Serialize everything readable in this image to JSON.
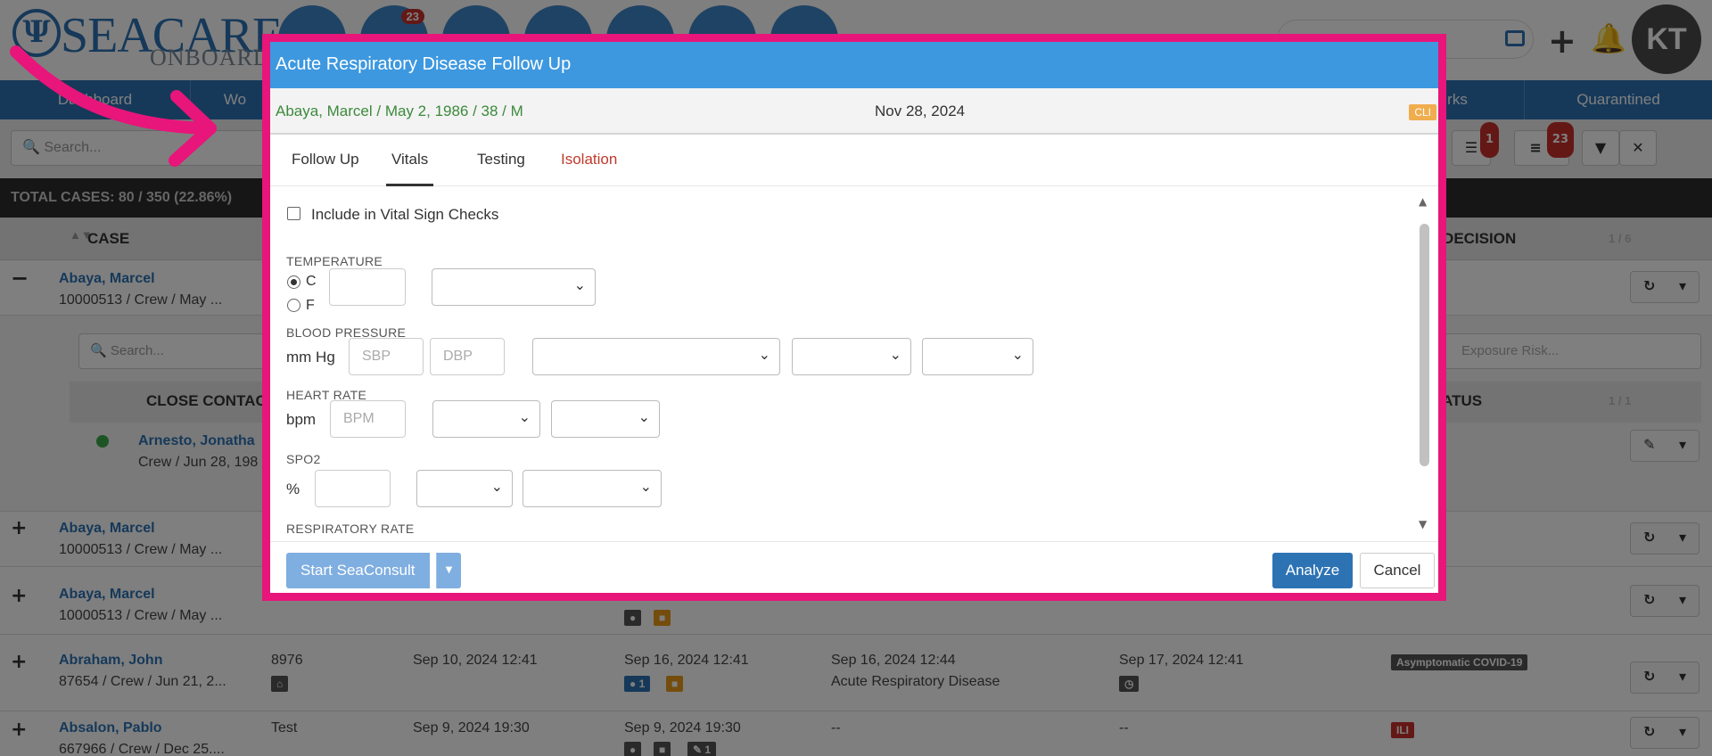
{
  "app": {
    "logo_text": "SEACARE",
    "logo_sub": "ONBOARD",
    "logo_glyph": "Ψ",
    "nav_badge": "23",
    "avatar_initials": "KT",
    "nav": [
      "Dashboard",
      "Wo",
      "rks",
      "Quarantined"
    ],
    "search_placeholder": "Search...",
    "filter_badge": "1",
    "list_badge": "23",
    "total_cases": "TOTAL CASES: 80 / 350 (22.86%)",
    "col_case": "CASE",
    "col_decision": "E DECISION",
    "pager_main": "1 / 6",
    "sub_search_placeholder": "Search...",
    "exposure_placeholder": "Exposure Risk...",
    "col_close_contact": "CLOSE CONTAC",
    "col_status": "TATUS",
    "pager_sub": "1 / 1",
    "rows": [
      {
        "name": "Abaya, Marcel",
        "detail": "10000513 / Crew / May ..."
      },
      {
        "name": "Arnesto, Jonatha",
        "detail": "Crew / Jun 28, 198"
      },
      {
        "name": "Abaya, Marcel",
        "detail": "10000513 / Crew / May ..."
      },
      {
        "name": "Abaya, Marcel",
        "detail": "10000513 / Crew / May ..."
      },
      {
        "name": "Abraham, John",
        "detail": "87654 / Crew / Jun 21, 2...",
        "c2": "8976",
        "c3": "Sep 10, 2024 12:41",
        "c4": "Sep 16, 2024 12:41",
        "c4tag": "1",
        "c5": "Sep 16, 2024 12:44",
        "c5b": "Acute Respiratory Disease",
        "c6": "Sep 17, 2024 12:41",
        "tag": "Asymptomatic COVID-19"
      },
      {
        "name": "Absalon, Pablo",
        "detail": "667966 / Crew / Dec 25....",
        "c2": "Test",
        "c3": "Sep 9, 2024 19:30",
        "c4": "Sep 9, 2024 19:30",
        "c4tag": "1",
        "c5": "--",
        "c6": "--",
        "tag": "ILI"
      }
    ]
  },
  "modal": {
    "title": "Acute Respiratory Disease Follow Up",
    "patient": "Abaya, Marcel / May 2, 1986 / 38 / M",
    "date": "Nov 28, 2024",
    "badge": "CLI",
    "tabs": [
      "Follow Up",
      "Vitals",
      "Testing",
      "Isolation"
    ],
    "include_label": "Include in Vital Sign Checks",
    "temperature": {
      "label": "TEMPERATURE",
      "unit_c": "C",
      "unit_f": "F"
    },
    "blood_pressure": {
      "label": "BLOOD PRESSURE",
      "unit": "mm Hg",
      "sbp": "SBP",
      "dbp": "DBP"
    },
    "heart_rate": {
      "label": "HEART RATE",
      "unit": "bpm",
      "bpm": "BPM"
    },
    "spo2": {
      "label": "SPO2",
      "unit": "%"
    },
    "respiratory_rate": {
      "label": "RESPIRATORY RATE"
    },
    "start_button": "Start SeaConsult",
    "analyze_button": "Analyze",
    "cancel_button": "Cancel"
  },
  "colors": {
    "accent": "#3d98df",
    "brand": "#2d73b4",
    "frame": "#e8157a"
  }
}
